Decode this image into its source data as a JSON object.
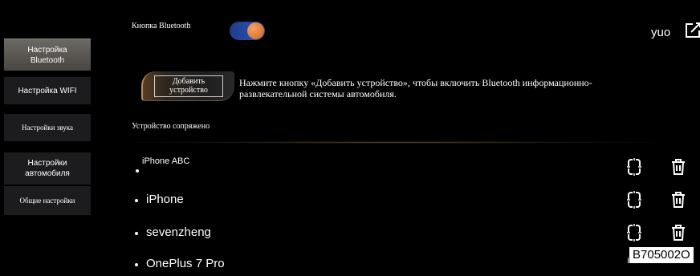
{
  "sidebar": {
    "items": [
      {
        "label": "Настройка\nBluetooth",
        "active": true
      },
      {
        "label": "Настройка WIFI",
        "active": false
      },
      {
        "label": "Настройки звука",
        "active": false
      },
      {
        "label": "Настройки\nавтомобиля",
        "active": false
      },
      {
        "label": "Общие настройки",
        "active": false
      }
    ]
  },
  "header": {
    "bluetooth_label": "Кнопка Bluetooth",
    "bluetooth_on": true,
    "user_name": "yuo",
    "edit_icon": "edit-icon"
  },
  "add_device": {
    "button_label": "Добавить\nустройство",
    "hint": "Нажмите кнопку «Добавить устройство», чтобы включить Bluetooth информационно-развлекательной системы автомобиля."
  },
  "paired": {
    "title": "Устройство сопряжено",
    "devices": [
      {
        "name": "iPhone ABC"
      },
      {
        "name": "iPhone"
      },
      {
        "name": "sevenzheng"
      },
      {
        "name": "OnePlus 7 Pro"
      }
    ],
    "disconnect_icon": "disconnect-icon",
    "delete_icon": "trash-icon"
  },
  "watermark": "B705002O",
  "colors": {
    "background": "#000000",
    "sidebar_item": "#1c1c1e",
    "sidebar_active": "#5f5b56",
    "toggle_track": "#2a55b8",
    "toggle_knob": "#e07b37",
    "accent_bronze": "#b8895c"
  }
}
